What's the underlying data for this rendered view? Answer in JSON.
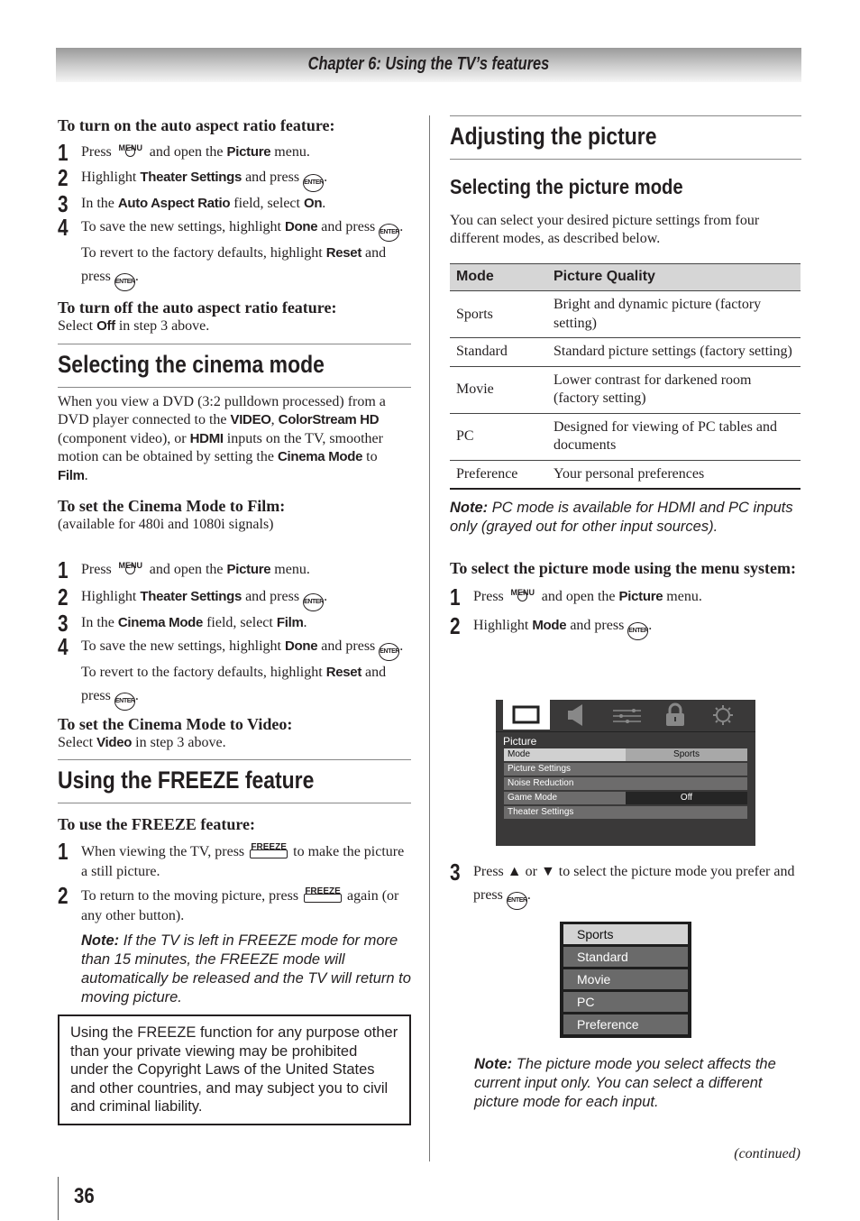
{
  "header": {
    "title": "Chapter 6: Using the TV’s features"
  },
  "buttons": {
    "menu": "MENU",
    "enter": "ENTER",
    "freeze": "FREEZE"
  },
  "left": {
    "auto_on": {
      "heading": "To turn on the auto aspect ratio feature:",
      "steps": [
        {
          "num": "1",
          "t1": "Press",
          "t2": "and open the",
          "b1": "Picture",
          "t3": "menu."
        },
        {
          "num": "2",
          "t1": "Highlight",
          "b1": "Theater Settings",
          "t2": "and press",
          "t3": "."
        },
        {
          "num": "3",
          "t1": "In the",
          "b1": "Auto Aspect Ratio",
          "t2": "field, select",
          "b2": "On",
          "t3": "."
        },
        {
          "num": "4",
          "t1": "To save the new settings, highlight",
          "b1": "Done",
          "t2": "and press",
          "t3": ". To revert to the factory defaults, highlight",
          "b2": "Reset",
          "t4": "and press",
          "t5": "."
        }
      ]
    },
    "auto_off": {
      "heading": "To turn off the auto aspect ratio feature:",
      "t1": "Select",
      "b1": "Off",
      "t2": "in step 3 above."
    },
    "cinema": {
      "title": "Selecting the cinema mode",
      "para": {
        "t1": "When you view a DVD (3:2 pulldown processed) from a DVD player connected to the",
        "b1": "VIDEO",
        "t2": ",",
        "b2": "ColorStream HD",
        "t3": "(component video), or",
        "b3": "HDMI",
        "t4": "inputs on the TV, smoother motion can be obtained by setting the",
        "b4": "Cinema Mode",
        "t5": "to",
        "b5": "Film",
        "t6": "."
      },
      "film_heading": "To set the Cinema Mode to Film:",
      "film_sub": "(available for 480i and 1080i signals)",
      "steps": [
        {
          "num": "1",
          "t1": "Press",
          "t2": "and open the",
          "b1": "Picture",
          "t3": "menu."
        },
        {
          "num": "2",
          "t1": "Highlight",
          "b1": "Theater Settings",
          "t2": "and press",
          "t3": "."
        },
        {
          "num": "3",
          "t1": "In the",
          "b1": "Cinema Mode",
          "t2": "field, select",
          "b2": "Film",
          "t3": "."
        },
        {
          "num": "4",
          "t1": "To save the new settings, highlight",
          "b1": "Done",
          "t2": "and press",
          "t3": ". To revert to the factory defaults, highlight",
          "b2": "Reset",
          "t4": "and press",
          "t5": "."
        }
      ],
      "video_heading": "To set the Cinema Mode to Video:",
      "video": {
        "t1": "Select",
        "b1": "Video",
        "t2": "in step 3 above."
      }
    },
    "freeze": {
      "title": "Using the FREEZE feature",
      "heading": "To use the FREEZE feature:",
      "steps": [
        {
          "num": "1",
          "t1": "When viewing the TV, press",
          "t2": "to make the picture a still picture."
        },
        {
          "num": "2",
          "t1": "To return to the moving picture, press",
          "t2": "again (or any other button)."
        }
      ],
      "note_label": "Note:",
      "note": "If the TV is left in FREEZE mode for more than 15 minutes, the FREEZE mode will automatically be released and the TV will return to moving picture.",
      "warning": "Using the FREEZE function for any purpose other than your private viewing may be prohibited under the Copyright Laws of the United States and other countries, and may subject you to civil and criminal liability."
    }
  },
  "right": {
    "title": "Adjusting the picture",
    "subtitle": "Selecting the picture mode",
    "intro": "You can select your desired picture settings from four different modes, as described below.",
    "table": {
      "headers": [
        "Mode",
        "Picture Quality"
      ],
      "rows": [
        [
          "Sports",
          "Bright and dynamic picture (factory setting)"
        ],
        [
          "Standard",
          "Standard picture settings (factory setting)"
        ],
        [
          "Movie",
          "Lower contrast for darkened room (factory setting)"
        ],
        [
          "PC",
          "Designed for viewing of PC tables and documents"
        ],
        [
          "Preference",
          "Your personal preferences"
        ]
      ]
    },
    "note_label": "Note:",
    "note": "PC mode is available for HDMI and PC inputs only (grayed out for other input sources).",
    "menu_heading": "To select the picture mode using the menu system:",
    "steps": [
      {
        "num": "1",
        "t1": "Press",
        "t2": "and open the",
        "b1": "Picture",
        "t3": "menu."
      },
      {
        "num": "2",
        "t1": "Highlight",
        "b1": "Mode",
        "t2": "and press",
        "t3": "."
      },
      {
        "num": "3",
        "t1": "Press",
        "up": "▲",
        "t2": "or",
        "down": "▼",
        "t3": "to select the picture mode you prefer and press",
        "t4": "."
      }
    ],
    "tv_menu": {
      "tabs": [
        "picture-icon",
        "audio-icon",
        "preferences-icon",
        "lock-icon",
        "setup-icon"
      ],
      "title": "Picture",
      "rows": [
        {
          "label": "Mode",
          "value": "Sports"
        },
        {
          "label": "Picture Settings",
          "value": ""
        },
        {
          "label": "Noise Reduction",
          "value": ""
        },
        {
          "label": "Game Mode",
          "value": "Off"
        },
        {
          "label": "Theater Settings",
          "value": ""
        }
      ]
    },
    "mode_list": [
      "Sports",
      "Standard",
      "Movie",
      "PC",
      "Preference"
    ],
    "note2_label": "Note:",
    "note2": "The picture mode you select affects the current input only. You can select a different picture mode for each input.",
    "continued": "(continued)"
  },
  "footer": {
    "page_number": "36"
  }
}
